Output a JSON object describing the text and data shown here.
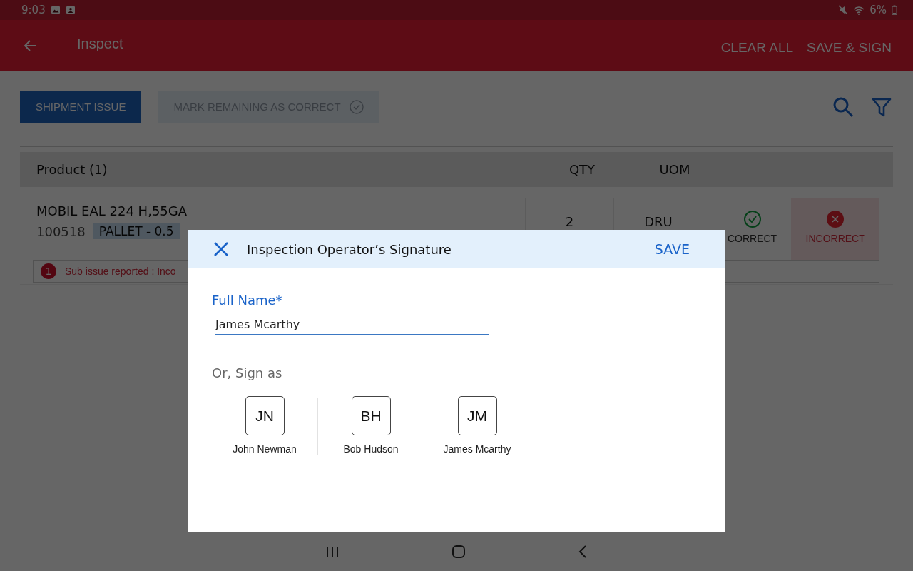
{
  "status_bar": {
    "time": "9:03",
    "battery": "6%"
  },
  "app_bar": {
    "title": "Inspect",
    "actions": [
      "CLEAR ALL",
      "SAVE & SIGN"
    ]
  },
  "toolbar": {
    "buttons": [
      {
        "label": "SHIPMENT ISSUE",
        "disabled": false
      },
      {
        "label": "MARK REMAINING AS CORRECT",
        "disabled": true
      }
    ]
  },
  "table": {
    "columns": [
      "Product (1)",
      "QTY",
      "UOM"
    ],
    "rows": [
      {
        "product": "MOBIL EAL 224 H,55GA",
        "code": "100518",
        "package": "PALLET - 0.5",
        "qty": "2",
        "uom": "DRU",
        "verdicts": [
          {
            "kind": "correct",
            "label": "CORRECT",
            "selected": false
          },
          {
            "kind": "incorrect",
            "label": "INCORRECT",
            "selected": true
          }
        ],
        "issue": {
          "count": "1",
          "text": "Sub issue reported : Inco"
        }
      }
    ]
  },
  "dialog": {
    "title": "Inspection Operator’s Signature",
    "action": "SAVE",
    "field": {
      "label": "Full Name*",
      "value": "James Mcarthy"
    },
    "sign_as_label": "Or, Sign as",
    "signers": [
      {
        "initials": "JN",
        "name": "John Newman"
      },
      {
        "initials": "BH",
        "name": "Bob Hudson"
      },
      {
        "initials": "JM",
        "name": "James Mcarthy"
      }
    ]
  }
}
